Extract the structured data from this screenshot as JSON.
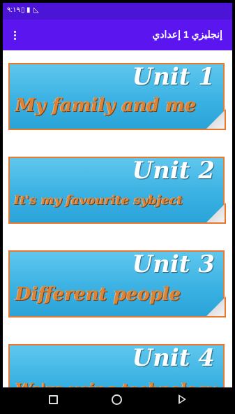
{
  "status_bar": {
    "time": "٩:١٩",
    "icons": [
      "sim-card-icon",
      "battery-icon",
      "no-signal-icon"
    ]
  },
  "toolbar": {
    "title": "إنجليزي 1 إعدادي",
    "menu_icon": "overflow-menu-icon"
  },
  "units": [
    {
      "number": "Unit 1",
      "title": "My family and me"
    },
    {
      "number": "Unit 2",
      "title": "It's my favourite sybject"
    },
    {
      "number": "Unit 3",
      "title": "Different people"
    },
    {
      "number": "Unit 4",
      "title": "We're using technology"
    }
  ],
  "colors": {
    "status_bar": "#4b14d6",
    "toolbar": "#5b16f0",
    "card_blue": "#3bb2e3",
    "card_border": "#e9772c",
    "title_orange": "#d8843a"
  },
  "nav_bar": {
    "icons": [
      "recents-icon",
      "home-icon",
      "back-icon"
    ]
  }
}
